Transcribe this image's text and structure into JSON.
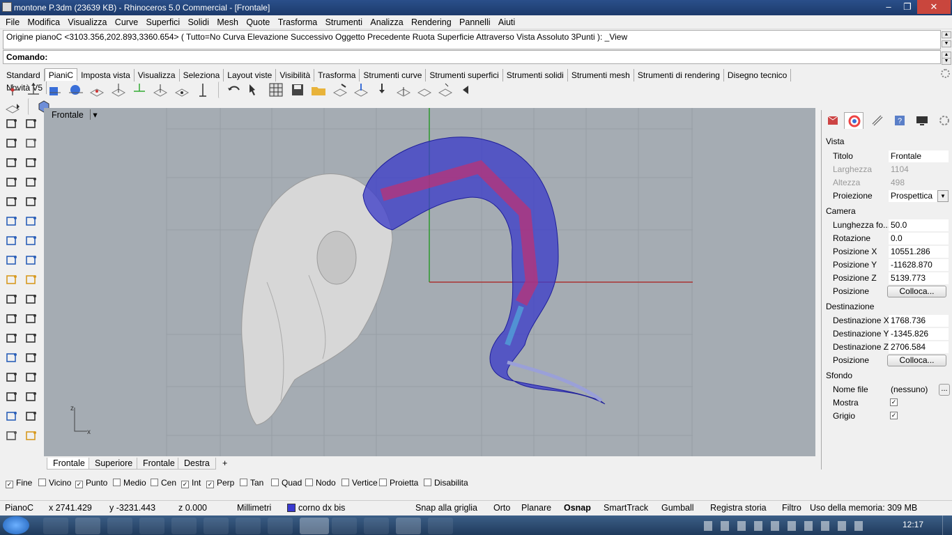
{
  "titlebar": {
    "title": "montone P.3dm (23639 KB) - Rhinoceros 5.0 Commercial - [Frontale]",
    "minimize": "‒",
    "maximize": "❐",
    "close": "✕"
  },
  "menu": [
    "File",
    "Modifica",
    "Visualizza",
    "Curve",
    "Superfici",
    "Solidi",
    "Mesh",
    "Quote",
    "Trasforma",
    "Strumenti",
    "Analizza",
    "Rendering",
    "Pannelli",
    "Aiuti"
  ],
  "command": {
    "history": "Origine pianoC <3103.356,202.893,3360.654> ( Tutto=No  Curva  Elevazione  Successivo  Oggetto  Precedente  Ruota  Superficie  Attraverso  Vista  Assoluto  3Punti ): _View",
    "prompt": "Comando:",
    "value": ""
  },
  "toolbar_tabs": [
    "Standard",
    "PianiC",
    "Imposta vista",
    "Visualizza",
    "Seleziona",
    "Layout viste",
    "Visibilità",
    "Trasforma",
    "Strumenti curve",
    "Strumenti superfici",
    "Strumenti solidi",
    "Strumenti mesh",
    "Strumenti di rendering",
    "Disegno tecnico",
    "Novità V5"
  ],
  "toolbar_tab_active": "PianiC",
  "viewport": {
    "title": "Frontale",
    "dropdown": "▾",
    "axis_z": "z",
    "axis_x": "x",
    "tabs": [
      "Frontale",
      "Superiore",
      "Frontale",
      "Destra"
    ],
    "add_tab": "+"
  },
  "osnap": [
    {
      "label": "Fine",
      "checked": true
    },
    {
      "label": "Vicino",
      "checked": false
    },
    {
      "label": "Punto",
      "checked": true
    },
    {
      "label": "Medio",
      "checked": false
    },
    {
      "label": "Cen",
      "checked": false
    },
    {
      "label": "Int",
      "checked": true
    },
    {
      "label": "Perp",
      "checked": true
    },
    {
      "label": "Tan",
      "checked": false
    },
    {
      "label": "Quad",
      "checked": false
    },
    {
      "label": "Nodo",
      "checked": false
    },
    {
      "label": "Vertice",
      "checked": false
    },
    {
      "label": "Proietta",
      "checked": false
    },
    {
      "label": "Disabilita",
      "checked": false
    }
  ],
  "status": {
    "cplane": "PianoC",
    "x": "x 2741.429",
    "y": "y -3231.443",
    "z": "z 0.000",
    "units": "Millimetri",
    "layer": "corno dx bis",
    "layer_color": "#3a3ad0",
    "snap": "Snap alla griglia",
    "orto": "Orto",
    "planare": "Planare",
    "osnap": "Osnap",
    "smarttrack": "SmartTrack",
    "gumball": "Gumball",
    "history": "Registra storia",
    "filtro": "Filtro",
    "memory": "Uso della memoria: 309 MB"
  },
  "panel": {
    "vista_header": "Vista",
    "titolo_label": "Titolo",
    "titolo": "Frontale",
    "larghezza_label": "Larghezza",
    "larghezza": "1104",
    "altezza_label": "Altezza",
    "altezza": "498",
    "proiezione_label": "Proiezione",
    "proiezione": "Prospettica",
    "camera_header": "Camera",
    "lunghezza_label": "Lunghezza fo...",
    "lunghezza": "50.0",
    "rotazione_label": "Rotazione",
    "rotazione": "0.0",
    "posx_label": "Posizione X",
    "posx": "10551.286",
    "posy_label": "Posizione Y",
    "posy": "-11628.870",
    "posz_label": "Posizione Z",
    "posz": "5139.773",
    "posizione_label": "Posizione",
    "colloca": "Colloca...",
    "dest_header": "Destinazione",
    "destx_label": "Destinazione X",
    "destx": "1768.736",
    "desty_label": "Destinazione Y",
    "desty": "-1345.826",
    "destz_label": "Destinazione Z",
    "destz": "2706.584",
    "sfondo_header": "Sfondo",
    "nomefile_label": "Nome file",
    "nomefile": "(nessuno)",
    "browse": "...",
    "mostra_label": "Mostra",
    "mostra": true,
    "grigio_label": "Grigio",
    "grigio": true,
    "check": "✓"
  },
  "taskbar": {
    "clock": "12:17"
  }
}
